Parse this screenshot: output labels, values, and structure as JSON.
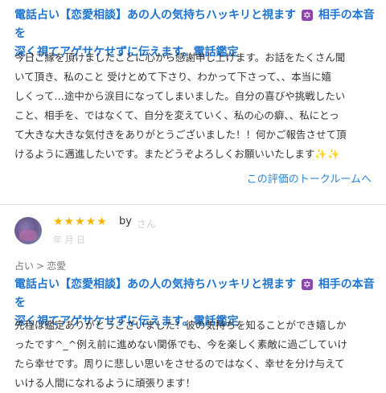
{
  "review1": {
    "title_part1": "電話占い【恋愛相談】あの人の気持ちハッキリと視ます",
    "title_part2": "相手の本音を",
    "title_line2": "深く視てアゲサケせずに伝えます。電話鑑定",
    "title_icon": "star-of-david-icon",
    "body_lines": [
      "今日ご縁を頂けましたことに心から感謝申し上げます。お話をたくさん聞",
      "いて頂き、私のこと 受けとめて下さり、わかって下さって、、本当に嬉",
      "しくって…途中から涙目になってしまいました。自分の喜びや挑戦したい",
      "こと、相手を、ではなくて、自分を変えていく、私の心の癖、、私にとっ",
      "て大きな大きな気付きをありがとうございました！！何かご報告させて頂",
      "けるように邁進したいです。またどうぞよろしくお願いいたします"
    ],
    "sparkles": "✨✨",
    "talk_link": "この評価のトークルームへ"
  },
  "review2": {
    "stars": "★★★★★",
    "rating": 5,
    "by_label": "by",
    "username": "さん",
    "date": "年 月 日",
    "breadcrumb": [
      "占い",
      ">",
      "恋愛"
    ],
    "title_part1": "電話占い【恋愛相談】あの人の気持ちハッキリと視ます",
    "title_part2": "相手の本音を",
    "title_line2": "深く視てアゲサケせずに伝えます。電話鑑定",
    "body_lines": [
      "先程は鑑定ありがとうございました！彼の気持ちを知ることができ嬉しか",
      "ったです^_^例え前に進めない関係でも、今を楽しく素敵に過ごしていけ",
      "たら幸せです。周りに悲しい思いをさせるのではなく、幸せを分け与えて",
      "いける人間になれるように頑張ります！"
    ]
  },
  "colors": {
    "link": "#1f74cf",
    "star": "#f5b400",
    "icon_bg": "#8e44ad"
  }
}
